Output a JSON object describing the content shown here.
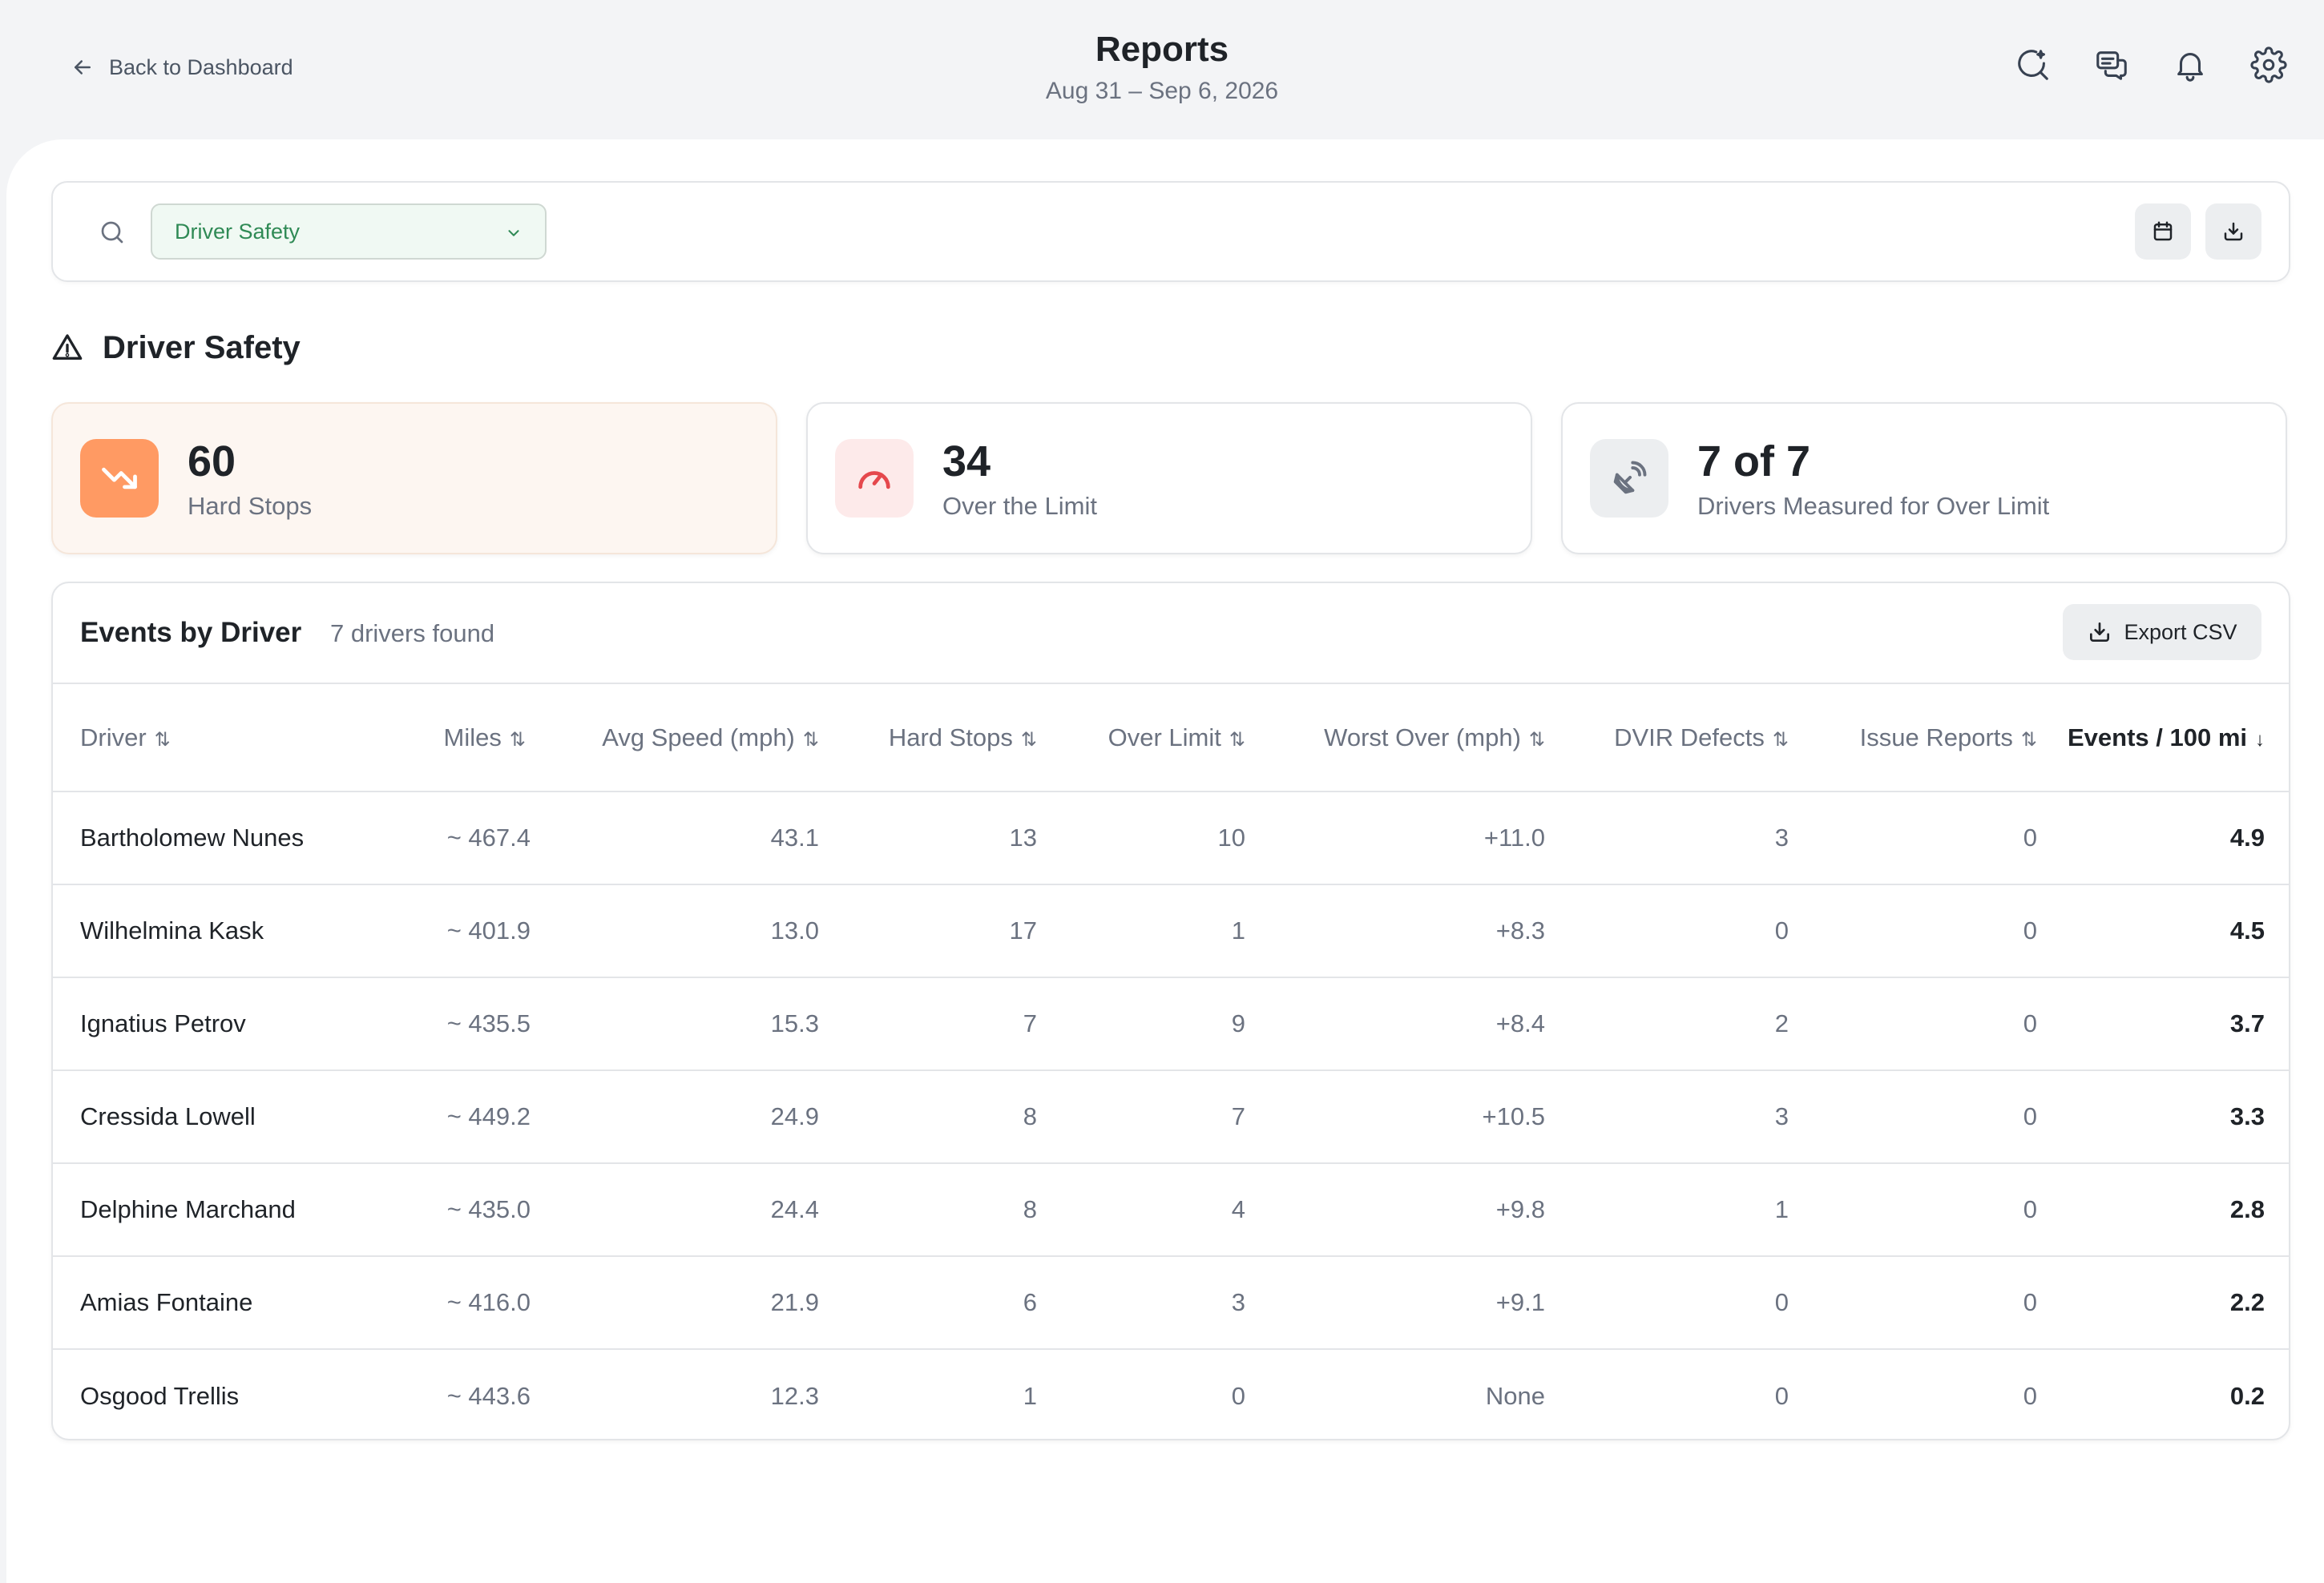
{
  "header": {
    "back_label": "Back to Dashboard",
    "title": "Reports",
    "date_range": "Aug 31 – Sep 6, 2026",
    "icons": [
      "ai-search-icon",
      "messages-icon",
      "bell-icon",
      "gear-icon"
    ]
  },
  "filter": {
    "report_type": "Driver Safety"
  },
  "section": {
    "title": "Driver Safety"
  },
  "kpis": [
    {
      "value": "60",
      "label": "Hard Stops",
      "icon": "trend-down-icon",
      "accent": "#ff8a50"
    },
    {
      "value": "34",
      "label": "Over the Limit",
      "icon": "speedometer-icon",
      "accent": "#e5484d"
    },
    {
      "value": "7 of 7",
      "label": "Drivers Measured for Over Limit",
      "icon": "satellite-icon",
      "accent": "#6b7280"
    }
  ],
  "table": {
    "title": "Events by Driver",
    "count_text": "7 drivers found",
    "export_label": "Export CSV",
    "columns": [
      {
        "label": "Driver",
        "sort": "⇅"
      },
      {
        "label": "Miles",
        "sort": "⇅"
      },
      {
        "label": "Avg Speed (mph)",
        "sort": "⇅"
      },
      {
        "label": "Hard Stops",
        "sort": "⇅"
      },
      {
        "label": "Over Limit",
        "sort": "⇅"
      },
      {
        "label": "Worst Over (mph)",
        "sort": "⇅"
      },
      {
        "label": "DVIR Defects",
        "sort": "⇅"
      },
      {
        "label": "Issue Reports",
        "sort": "⇅"
      },
      {
        "label": "Events / 100 mi",
        "sort": "↓"
      }
    ],
    "rows": [
      [
        "Bartholomew Nunes",
        "~ 467.4",
        "43.1",
        "13",
        "10",
        "+11.0",
        "3",
        "0",
        "4.9"
      ],
      [
        "Wilhelmina Kask",
        "~ 401.9",
        "13.0",
        "17",
        "1",
        "+8.3",
        "0",
        "0",
        "4.5"
      ],
      [
        "Ignatius Petrov",
        "~ 435.5",
        "15.3",
        "7",
        "9",
        "+8.4",
        "2",
        "0",
        "3.7"
      ],
      [
        "Cressida Lowell",
        "~ 449.2",
        "24.9",
        "8",
        "7",
        "+10.5",
        "3",
        "0",
        "3.3"
      ],
      [
        "Delphine Marchand",
        "~ 435.0",
        "24.4",
        "8",
        "4",
        "+9.8",
        "1",
        "0",
        "2.8"
      ],
      [
        "Amias Fontaine",
        "~ 416.0",
        "21.9",
        "6",
        "3",
        "+9.1",
        "0",
        "0",
        "2.2"
      ],
      [
        "Osgood Trellis",
        "~ 443.6",
        "12.3",
        "1",
        "0",
        "None",
        "0",
        "0",
        "0.2"
      ]
    ]
  }
}
